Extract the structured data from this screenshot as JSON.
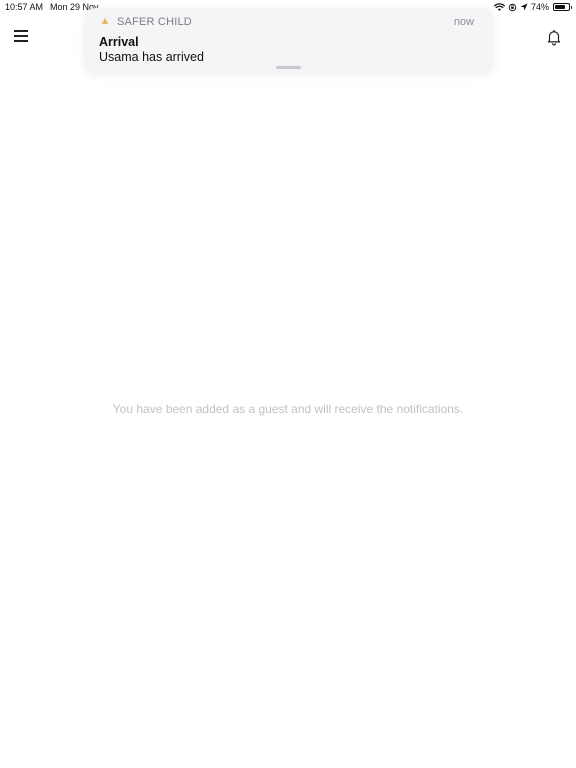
{
  "status_bar": {
    "time": "10:57 AM",
    "date": "Mon 29 Nov",
    "battery": "74%",
    "battery_level": 0.74,
    "icons": [
      "wifi-icon",
      "screen-lock-rotation-icon",
      "location-arrow-icon",
      "battery-icon"
    ]
  },
  "header": {
    "menu_icon": "hamburger-menu-icon",
    "notifications_icon": "bell-icon"
  },
  "notification": {
    "app_name": "SAFER CHILD",
    "time": "now",
    "title": "Arrival",
    "body": "Usama has arrived",
    "app_icon": "safer-child-app-icon"
  },
  "main": {
    "empty_message": "You have been added as a guest and will receive the notifications."
  },
  "colors": {
    "text_primary": "#111111",
    "text_muted": "#c2c2c6",
    "banner_bg": "#f5f5f7"
  }
}
